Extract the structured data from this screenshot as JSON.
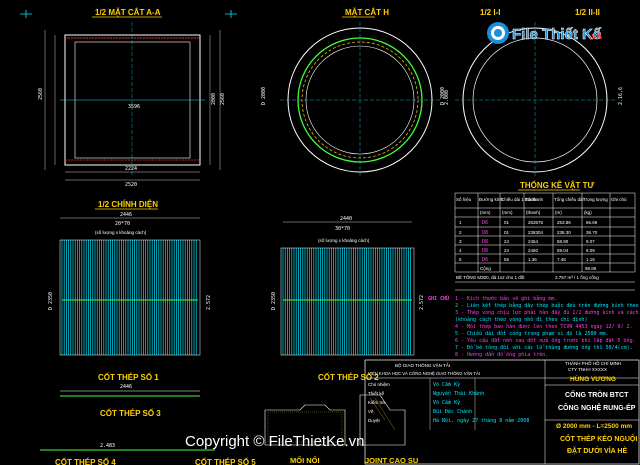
{
  "watermark": {
    "brand": "File Thiết Kế",
    "domain": ".vn",
    "footer": "Copyright © FileThietKe.vn"
  },
  "titles": {
    "sec_aa": "1/2 MẶT CẮT A-A",
    "sec_h": "MẶT CẮT H",
    "sec_ii": "1/2 I-I",
    "sec_iii": "1/2 II-II",
    "elevation": "1/2 CHÍNH DIỆN",
    "rebar1": "CỐT THÉP SỐ 1",
    "rebar2": "CỐT THÉP SỐ 2",
    "rebar3": "CỐT THÉP SỐ 3",
    "rebar4": "CỐT THÉP SỐ 4",
    "rebar5": "CỐT THÉP SỐ 5",
    "joint1": "MỐI NỐI",
    "joint2": "JOINT CAO SU"
  },
  "dims": {
    "aa_bottom": "3596",
    "aa_bottom2": "2224",
    "aa_total": "2520",
    "aa_left": "2560",
    "aa_right": "2000",
    "aa_right2": "2560",
    "el_top": "2446",
    "el_top2": "20*70",
    "el_note": "(số lượng x khoảng cách)",
    "el_left": "D 2350",
    "el_right": "2.572",
    "r2_top": "2440",
    "r2_top2": "30*70",
    "r2_left": "D 2350",
    "r2_right": "2.572",
    "r3_a": "2446",
    "r3_b": "2.483"
  },
  "table": {
    "title": "THỐNG KÊ VẬT TƯ",
    "headers": [
      "Số hiệu",
      "Đường kính",
      "Chiều dài 1 thanh",
      "Số thanh",
      "Tổng chiều dài",
      "Trọng lượng",
      "Ghi chú"
    ],
    "units": [
      "",
      "(mm)",
      "(mm)",
      "(thanh)",
      "(m)",
      "(kg)",
      ""
    ],
    "rows": [
      [
        "1",
        "D6",
        "01",
        "253575",
        "253.86",
        "66.69",
        ""
      ],
      [
        "2",
        "D8",
        "01",
        "238304",
        "238.30",
        "36.70",
        ""
      ],
      [
        "3",
        "D8",
        "24",
        "2454",
        "58.90",
        "9.07",
        ""
      ],
      [
        "4",
        "D8",
        "24",
        "2460",
        "59.04",
        "9.09",
        ""
      ],
      [
        "5",
        "D6",
        "55",
        "1.36",
        "7.48",
        "1.16",
        ""
      ]
    ],
    "total_label": "Cộng",
    "total": "98.88",
    "concrete_label": "BÊ TÔNG M300, đá 1x2 cho 1 đốt",
    "concrete": "2.757 m³ / 1 ống cống"
  },
  "notes": {
    "title": "GHI CHÚ",
    "lines": [
      "1 - Kích thước bản vẽ ghi bằng mm.",
      "2 - Liên kết thép bằng dây thép buộc đều trên đường kính theo chu vi ống xuống hay lưới",
      "3 - Thép vòng chịu lực phải hàn đầy đủ 1/2 đường kính và cách",
      "     (khoảng cách theo vòng nhỏ đi theo chỉ định)",
      "4 - Mối thép bao hàn được lên theo TCVN 4453 ngày 12/ 0/ 2.",
      "5 - Chiều dài đốt cống trong phạm vi đó là 2500 mm.",
      "6 - Yêu cầu đất nền sau đốt nửa ống trước khi lắp đặt 5 ống.",
      "7 - Đổ bê tông đối với các lỗ thủng đường ống thì 50/4(cm).",
      "8 - Hướng dẫn đổ ống phía trên."
    ]
  },
  "titleblock": {
    "client1": "THÀNH PHỐ HỒ CHÍ MINH",
    "client2": "CTY TNHH XXXXX",
    "firm1": "BỘ GIAO THÔNG VẬN TẢI",
    "firm2": "VIỆN KHOA HỌC VÀ CÔNG NGHỆ GIAO THÔNG VẬN TẢI",
    "project": "HÙNG VƯƠNG",
    "sheet_title1": "CỐNG TRÒN BTCT",
    "sheet_title2": "CÔNG NGHỆ RUNG-ÉP",
    "dia": "Ø 2000 mm - L=2500 mm",
    "desc1": "CỐT THÉP KÉO NGUỘI",
    "desc2": "ĐẶT DƯỚI VỈA HÈ",
    "roles": [
      "Chủ nhiệm",
      "Thiết kế",
      "Kiểm tra",
      "Vẽ",
      "Duyệt"
    ],
    "names": [
      "Võ Cẩm Kỳ",
      "Nguyễn Thái Khánh",
      "Võ Cẩm Kỳ",
      "Bùi Đức Chánh",
      "Hà Nội, ngày 27 tháng 8 năm 2008"
    ]
  }
}
